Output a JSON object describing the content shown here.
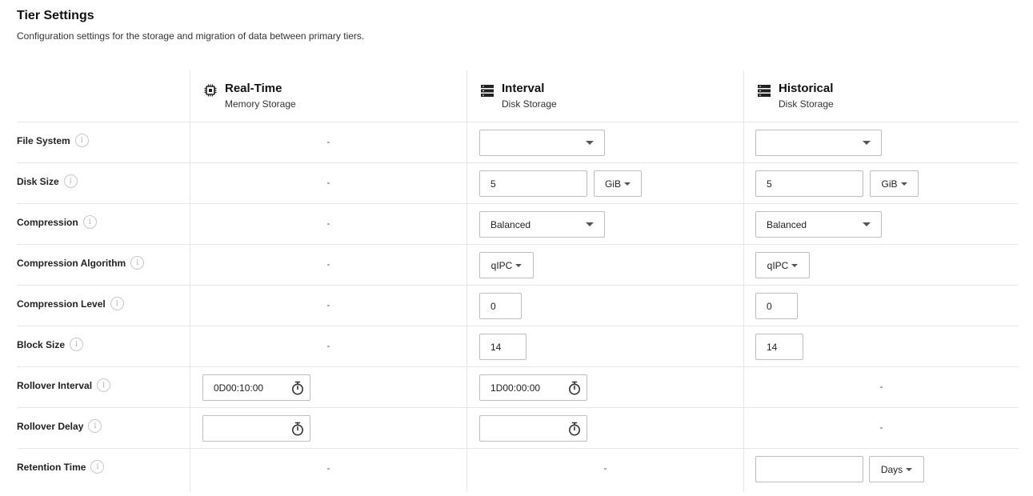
{
  "page": {
    "title": "Tier Settings",
    "subtitle": "Configuration settings for the storage and migration of data between primary tiers."
  },
  "tiers": [
    {
      "name": "Real-Time",
      "storage": "Memory Storage",
      "icon": "chip-icon"
    },
    {
      "name": "Interval",
      "storage": "Disk Storage",
      "icon": "server-icon"
    },
    {
      "name": "Historical",
      "storage": "Disk Storage",
      "icon": "server-icon"
    }
  ],
  "rows": {
    "file_system": {
      "label": "File System"
    },
    "disk_size": {
      "label": "Disk Size"
    },
    "compression": {
      "label": "Compression"
    },
    "compression_algorithm": {
      "label": "Compression Algorithm"
    },
    "compression_level": {
      "label": "Compression Level"
    },
    "block_size": {
      "label": "Block Size"
    },
    "rollover_interval": {
      "label": "Rollover Interval"
    },
    "rollover_delay": {
      "label": "Rollover Delay"
    },
    "retention_time": {
      "label": "Retention Time"
    }
  },
  "placeholder": "-",
  "interval": {
    "file_system": "",
    "disk_size": "5",
    "disk_size_unit": "GiB",
    "compression": "Balanced",
    "compression_algorithm": "qIPC",
    "compression_level": "0",
    "block_size": "14",
    "rollover_interval": "1D00:00:00",
    "rollover_delay": ""
  },
  "historical": {
    "file_system": "",
    "disk_size": "5",
    "disk_size_unit": "GiB",
    "compression": "Balanced",
    "compression_algorithm": "qIPC",
    "compression_level": "0",
    "block_size": "14",
    "retention_time": "",
    "retention_time_unit": "Days"
  },
  "realtime": {
    "rollover_interval": "0D00:10:00",
    "rollover_delay": ""
  },
  "icons": {
    "info": "i"
  }
}
